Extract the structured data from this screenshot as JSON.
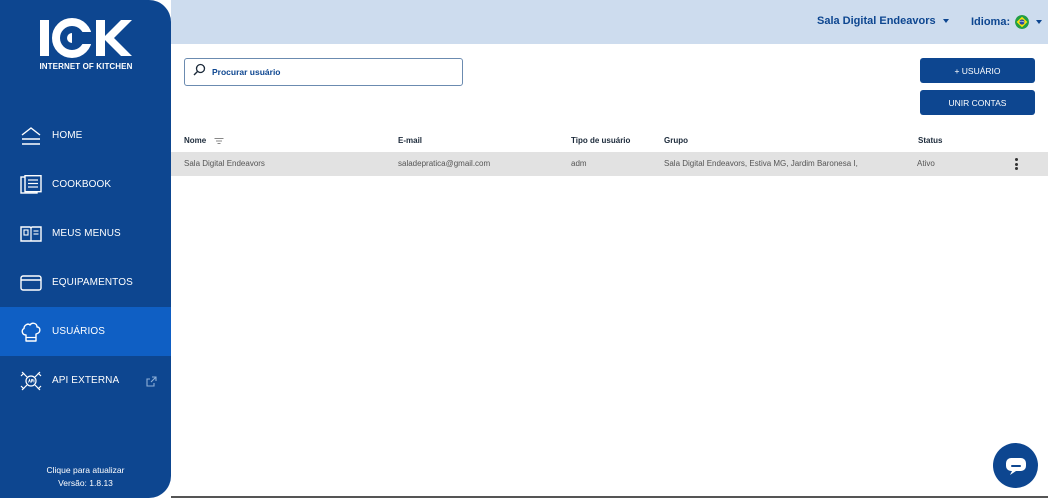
{
  "brand": {
    "logo_text": "IOK",
    "tagline": "INTERNET OF KITCHEN",
    "color_primary": "#0d4690",
    "color_active": "#0f5fc4"
  },
  "sidebar": {
    "items": [
      {
        "label": "HOME",
        "icon": "home-icon"
      },
      {
        "label": "COOKBOOK",
        "icon": "cookbook-icon"
      },
      {
        "label": "MEUS MENUS",
        "icon": "menus-icon"
      },
      {
        "label": "EQUIPAMENTOS",
        "icon": "equipment-icon"
      },
      {
        "label": "USUÁRIOS",
        "icon": "chef-hat-icon",
        "active": true
      },
      {
        "label": "API EXTERNA",
        "icon": "api-icon",
        "external": true
      }
    ],
    "footer": {
      "update_text": "Clique para atualizar",
      "version": "Versão: 1.8.13"
    }
  },
  "topbar": {
    "organization": "Sala Digital Endeavors",
    "language_label": "Idioma:"
  },
  "search": {
    "placeholder": "Procurar usuário"
  },
  "actions": {
    "add_user": "+ USUÁRIO",
    "merge_accounts": "UNIR CONTAS"
  },
  "table": {
    "headers": {
      "name": "Nome",
      "email": "E-mail",
      "user_type": "Tipo de usuário",
      "group": "Grupo",
      "status": "Status"
    },
    "rows": [
      {
        "name": "Sala Digital Endeavors",
        "email": "saladepratica@gmail.com",
        "user_type": "adm",
        "group": "Sala Digital Endeavors, Estiva MG, Jardim Baronesa I,",
        "status": "Ativo"
      }
    ]
  }
}
